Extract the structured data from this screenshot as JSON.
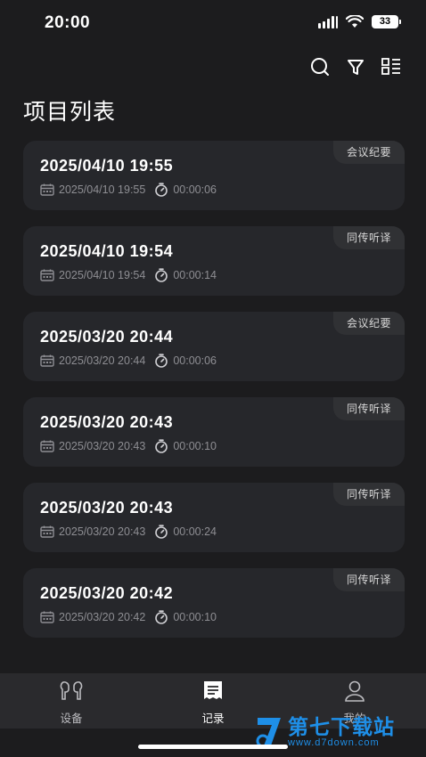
{
  "status": {
    "time": "20:00",
    "battery": "33"
  },
  "page_title": "项目列表",
  "toolbar": {
    "search_icon": "search-icon",
    "filter_icon": "filter-icon",
    "layout_icon": "layout-toggle-icon"
  },
  "records": [
    {
      "title": "2025/04/10 19:55",
      "date": "2025/04/10 19:55",
      "duration": "00:00:06",
      "tag": "会议纪要"
    },
    {
      "title": "2025/04/10 19:54",
      "date": "2025/04/10 19:54",
      "duration": "00:00:14",
      "tag": "同传听译"
    },
    {
      "title": "2025/03/20 20:44",
      "date": "2025/03/20 20:44",
      "duration": "00:00:06",
      "tag": "会议纪要"
    },
    {
      "title": "2025/03/20 20:43",
      "date": "2025/03/20 20:43",
      "duration": "00:00:10",
      "tag": "同传听译"
    },
    {
      "title": "2025/03/20 20:43",
      "date": "2025/03/20 20:43",
      "duration": "00:00:24",
      "tag": "同传听译"
    },
    {
      "title": "2025/03/20 20:42",
      "date": "2025/03/20 20:42",
      "duration": "00:00:10",
      "tag": "同传听译"
    }
  ],
  "tabs": [
    {
      "label": "设备",
      "icon": "earbuds-icon"
    },
    {
      "label": "记录",
      "icon": "notes-icon",
      "active": true
    },
    {
      "label": "我的",
      "icon": "profile-icon"
    }
  ],
  "watermark": {
    "text": "第七下载站",
    "url": "www.d7down.com"
  }
}
